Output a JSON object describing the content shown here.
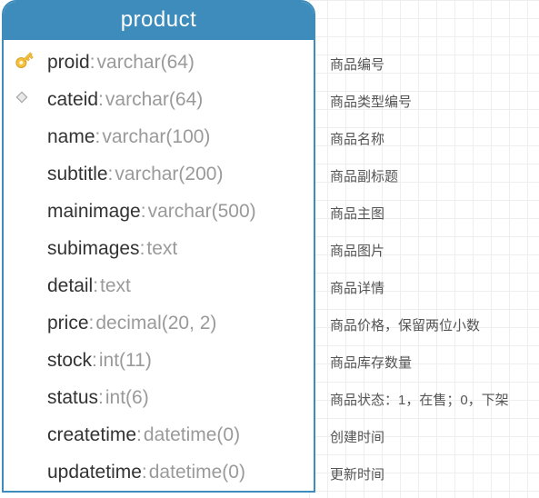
{
  "table": {
    "name": "product",
    "columns": [
      {
        "icon": "key",
        "name": "proid",
        "type": "varchar(64)",
        "desc": "商品编号"
      },
      {
        "icon": "diamond",
        "name": "cateid",
        "type": "varchar(64)",
        "desc": "商品类型编号"
      },
      {
        "icon": "",
        "name": "name",
        "type": "varchar(100)",
        "desc": "商品名称"
      },
      {
        "icon": "",
        "name": "subtitle",
        "type": "varchar(200)",
        "desc": "商品副标题"
      },
      {
        "icon": "",
        "name": "mainimage",
        "type": "varchar(500)",
        "desc": "商品主图"
      },
      {
        "icon": "",
        "name": "subimages",
        "type": "text",
        "desc": "商品图片"
      },
      {
        "icon": "",
        "name": "detail",
        "type": "text",
        "desc": "商品详情"
      },
      {
        "icon": "",
        "name": "price",
        "type": "decimal(20, 2)",
        "desc": "商品价格，保留两位小数"
      },
      {
        "icon": "",
        "name": "stock",
        "type": "int(11)",
        "desc": "商品库存数量"
      },
      {
        "icon": "",
        "name": "status",
        "type": "int(6)",
        "desc": "商品状态：1，在售；0，下架"
      },
      {
        "icon": "",
        "name": "createtime",
        "type": "datetime(0)",
        "desc": "创建时间"
      },
      {
        "icon": "",
        "name": "updatetime",
        "type": "datetime(0)",
        "desc": "更新时间"
      }
    ]
  }
}
